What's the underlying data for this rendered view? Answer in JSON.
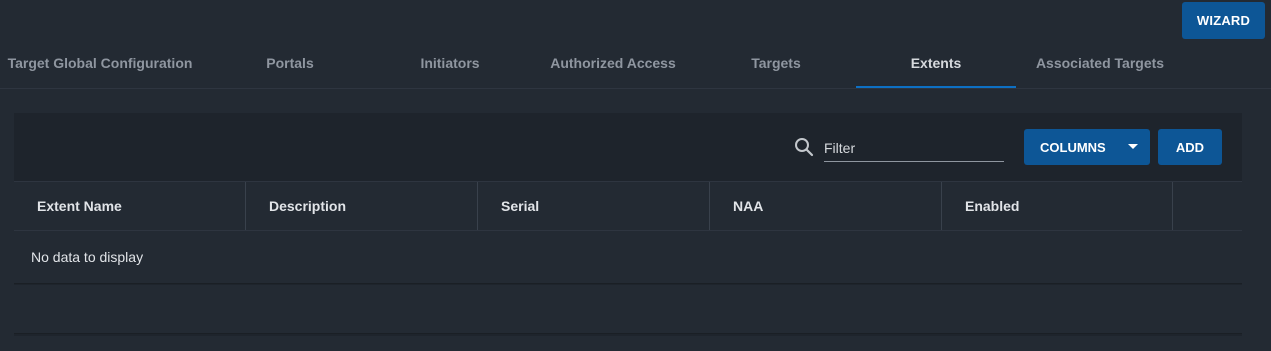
{
  "header": {
    "wizard_label": "WIZARD"
  },
  "tabs": [
    {
      "label": "Target Global Configuration",
      "active": false
    },
    {
      "label": "Portals",
      "active": false
    },
    {
      "label": "Initiators",
      "active": false
    },
    {
      "label": "Authorized Access",
      "active": false
    },
    {
      "label": "Targets",
      "active": false
    },
    {
      "label": "Extents",
      "active": true
    },
    {
      "label": "Associated Targets",
      "active": false
    }
  ],
  "toolbar": {
    "search_icon": "search-icon",
    "filter_placeholder": "Filter",
    "columns_label": "COLUMNS",
    "add_label": "ADD"
  },
  "table": {
    "columns": [
      "Extent Name",
      "Description",
      "Serial",
      "NAA",
      "Enabled"
    ],
    "empty_message": "No data to display"
  },
  "colors": {
    "background": "#232a33",
    "card": "#1e242c",
    "accent_button": "#0d5696",
    "active_tab_underline": "#0d70c4"
  }
}
